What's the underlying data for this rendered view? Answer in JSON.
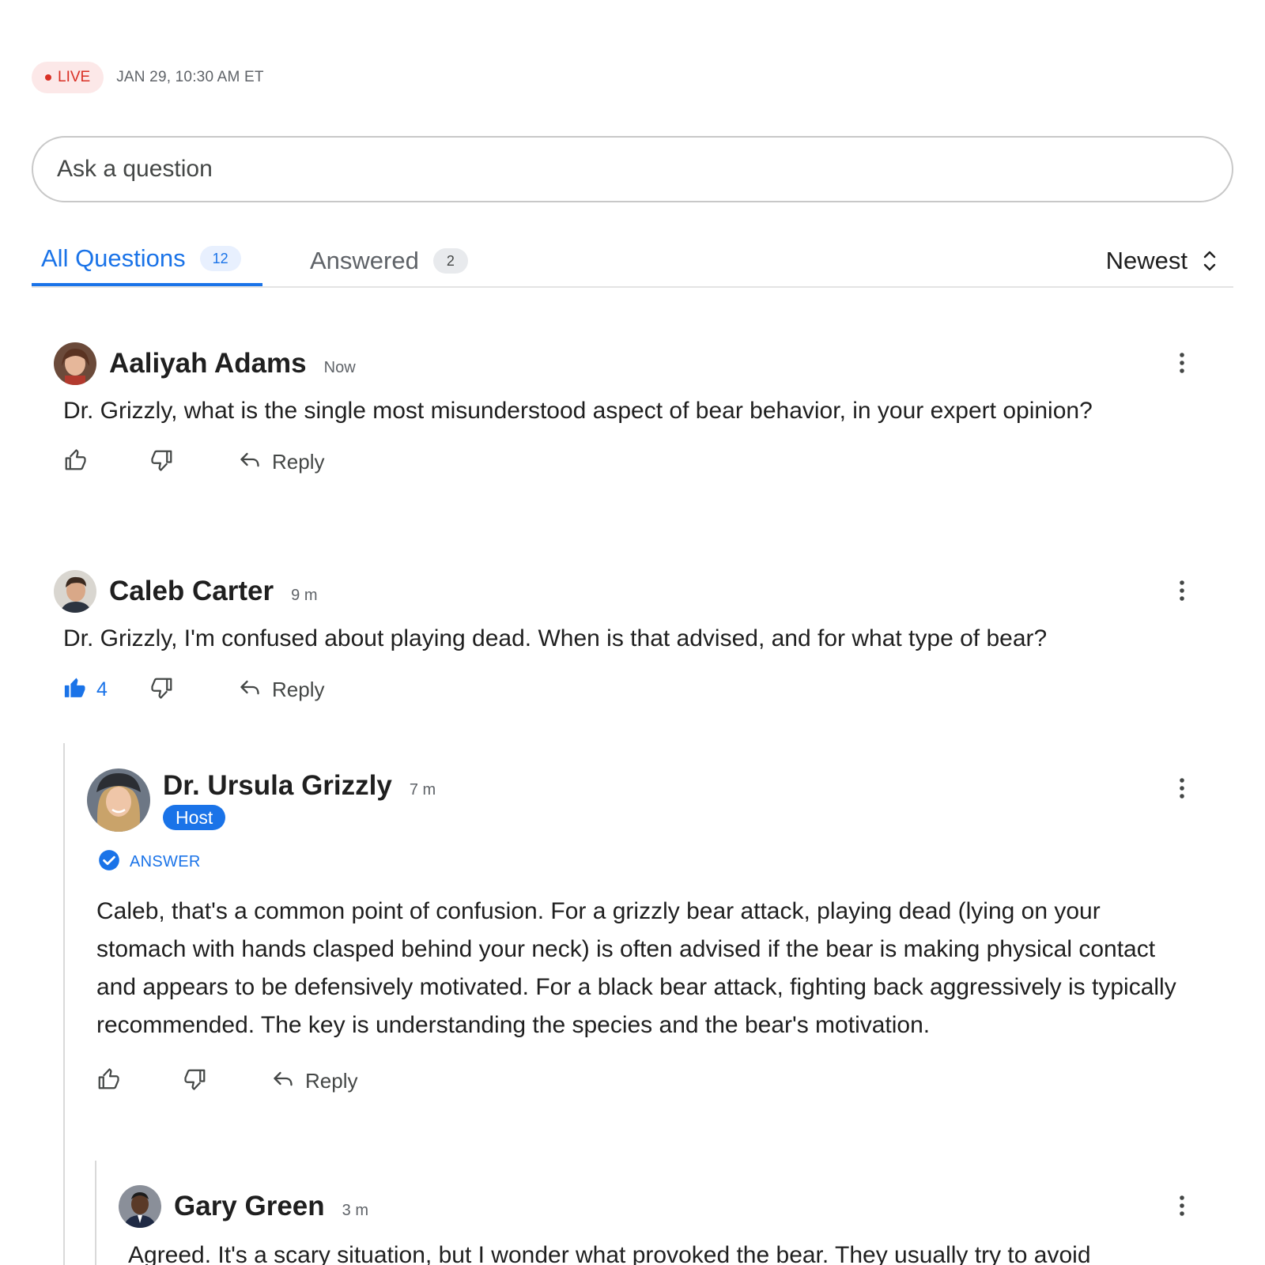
{
  "live": {
    "badge": "LIVE",
    "datetime": "JAN 29, 10:30 AM ET"
  },
  "ask": {
    "placeholder": "Ask a question"
  },
  "tabs": [
    {
      "label": "All Questions",
      "count": "12",
      "active": true
    },
    {
      "label": "Answered",
      "count": "2",
      "active": false
    }
  ],
  "sort": {
    "label": "Newest"
  },
  "colors": {
    "accent": "#1a73e8",
    "live": "#d93025",
    "text": "#1f1f1f",
    "muted": "#5f6368"
  },
  "comments": [
    {
      "name": "Aaliyah Adams",
      "time": "Now",
      "text": "Dr. Grizzly, what is the single most misunderstood aspect of bear behavior, in your expert opinion?",
      "likes": "",
      "liked": false,
      "reply_label": "Reply"
    },
    {
      "name": "Caleb Carter",
      "time": "9 m",
      "text": "Dr. Grizzly, I'm confused about playing dead. When is that advised, and for what type of bear?",
      "likes": "4",
      "liked": true,
      "reply_label": "Reply"
    },
    {
      "name": "Dr. Ursula Grizzly",
      "time": "7 m",
      "badge": "Host",
      "answer_label": "ANSWER",
      "text": "Caleb, that's a common point of confusion. For a grizzly bear attack, playing dead (lying on your stomach with hands clasped behind your neck) is often advised if the bear is making physical contact and appears to be defensively motivated. For a black bear attack, fighting back aggressively is typically recommended. The key is understanding the species and the bear's motivation.",
      "likes": "",
      "liked": false,
      "reply_label": "Reply"
    },
    {
      "name": "Gary Green",
      "time": "3 m",
      "text": "Agreed. It's a scary situation, but I wonder what provoked the bear. They usually try to avoid"
    }
  ],
  "icons": {
    "like": "thumb-up-icon",
    "like_filled": "thumb-up-filled-icon",
    "dislike": "thumb-down-icon",
    "reply": "reply-arrow-icon",
    "more": "more-vert-icon",
    "sort": "unfold-icon",
    "answer": "check-circle-icon"
  }
}
